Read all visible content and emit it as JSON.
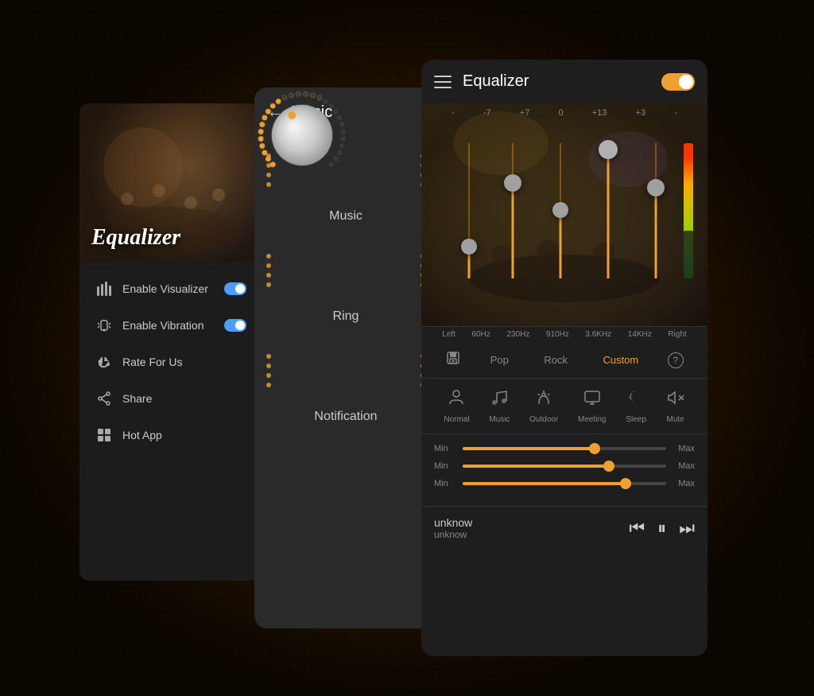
{
  "app": {
    "title": "Equalizer"
  },
  "left_panel": {
    "app_name": "Equalizer",
    "menu_items": [
      {
        "id": "visualizer",
        "label": "Enable Visualizer",
        "icon": "bars",
        "toggle": true
      },
      {
        "id": "vibration",
        "label": "Enable Vibration",
        "icon": "vibrate",
        "toggle": true
      },
      {
        "id": "rate",
        "label": "Rate For Us",
        "icon": "thumb-up"
      },
      {
        "id": "share",
        "label": "Share",
        "icon": "share"
      },
      {
        "id": "hotapp",
        "label": "Hot App",
        "icon": "grid"
      }
    ]
  },
  "middle_panel": {
    "title": "Music",
    "knobs": [
      {
        "label": "Music",
        "position": 0.3
      },
      {
        "label": "Ring",
        "position": 0.6
      },
      {
        "label": "Notification",
        "position": 0.4
      }
    ]
  },
  "eq_panel": {
    "title": "Equalizer",
    "toggle": true,
    "bands": [
      {
        "freq": "60Hz",
        "value": -7,
        "position": 0.7
      },
      {
        "freq": "230Hz",
        "value": 7,
        "position": 0.4
      },
      {
        "freq": "910Hz",
        "value": 0,
        "position": 0.55
      },
      {
        "freq": "3.6KHz",
        "value": 13,
        "position": 0.15
      },
      {
        "freq": "14KHz",
        "value": 3,
        "position": 0.35
      }
    ],
    "labels_top": [
      "-",
      "-7",
      "+7",
      "0",
      "+13",
      "+3",
      "-"
    ],
    "freq_labels": [
      "Left",
      "60Hz",
      "230Hz",
      "910Hz",
      "3.6KHz",
      "14KHz",
      "Right"
    ],
    "presets": [
      "Pop",
      "Rock",
      "Custom"
    ],
    "active_preset": "Custom",
    "sound_modes": [
      {
        "label": "Normal",
        "icon": "👤"
      },
      {
        "label": "Music",
        "icon": "🎵"
      },
      {
        "label": "Outdoor",
        "icon": "🔔"
      },
      {
        "label": "Meeting",
        "icon": "🖥"
      },
      {
        "label": "Sleep",
        "icon": "🌙"
      },
      {
        "label": "Mute",
        "icon": "🔇"
      }
    ],
    "sliders": [
      {
        "min": "Min",
        "max": "Max",
        "value": 65
      },
      {
        "min": "Min",
        "max": "Max",
        "value": 72
      },
      {
        "min": "Min",
        "max": "Max",
        "value": 80
      }
    ],
    "track": {
      "title": "unknow",
      "artist": "unknow"
    },
    "controls": {
      "prev": "⏮",
      "play": "⏸",
      "next": "⏭"
    }
  }
}
